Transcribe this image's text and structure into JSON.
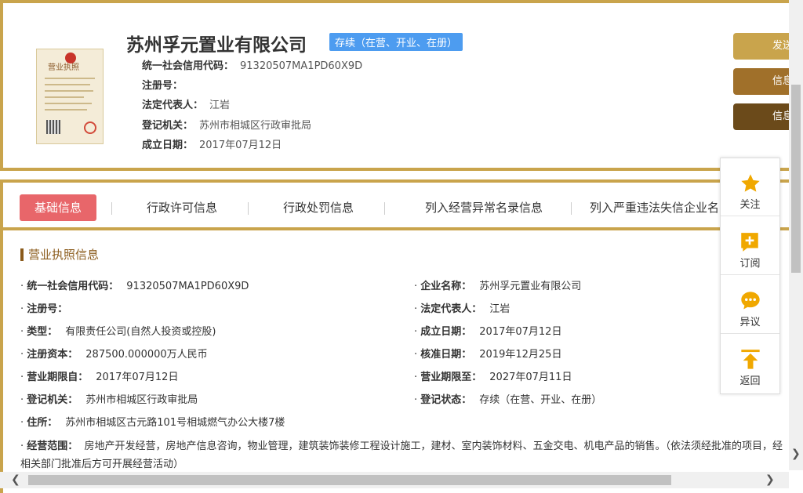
{
  "header": {
    "company_name": "苏州孚元置业有限公司",
    "status": "存续（在营、开业、在册）",
    "license_image": {
      "title": "营业执照"
    },
    "rows": [
      {
        "label": "统一社会信用代码：",
        "value": "91320507MA1PD60X9D"
      },
      {
        "label": "注册号：",
        "value": ""
      },
      {
        "label": "法定代表人：",
        "value": "江岩"
      },
      {
        "label": "登记机关：",
        "value": "苏州市相城区行政审批局"
      },
      {
        "label": "成立日期：",
        "value": "2017年07月12日"
      }
    ],
    "side_buttons": [
      {
        "label": "发送",
        "color": "#c9a44c"
      },
      {
        "label": "信息",
        "color": "#a0702a"
      },
      {
        "label": "信息",
        "color": "#6b4a1a"
      }
    ]
  },
  "tabs": [
    {
      "label": "基础信息",
      "active": true
    },
    {
      "label": "行政许可信息"
    },
    {
      "label": "行政处罚信息"
    },
    {
      "label": "列入经营异常名录信息"
    },
    {
      "label": "列入严重违法失信企业名"
    }
  ],
  "section": {
    "title": "营业执照信息"
  },
  "fields_left": [
    {
      "label": "统一社会信用代码：",
      "value": "91320507MA1PD60X9D"
    },
    {
      "label": "注册号：",
      "value": ""
    },
    {
      "label": "类型：",
      "value": "有限责任公司(自然人投资或控股)"
    },
    {
      "label": "注册资本：",
      "value": "287500.000000万人民币"
    },
    {
      "label": "营业期限自：",
      "value": "2017年07月12日"
    },
    {
      "label": "登记机关：",
      "value": "苏州市相城区行政审批局"
    },
    {
      "label": "住所：",
      "value": "苏州市相城区古元路101号相城燃气办公大楼7楼"
    }
  ],
  "fields_right": [
    {
      "label": "企业名称：",
      "value": "苏州孚元置业有限公司"
    },
    {
      "label": "法定代表人：",
      "value": "江岩"
    },
    {
      "label": "成立日期：",
      "value": "2017年07月12日"
    },
    {
      "label": "核准日期：",
      "value": "2019年12月25日"
    },
    {
      "label": "营业期限至：",
      "value": "2027年07月11日"
    },
    {
      "label": "登记状态：",
      "value": "存续（在营、开业、在册）"
    }
  ],
  "scope": {
    "label": "经营范围：",
    "value": "房地产开发经营，房地产信息咨询，物业管理，建筑装饰装修工程设计施工，建材、室内装饰材料、五金交电、机电产品的销售。（依法须经批准的项目，经相关部门批准后方可开展经营活动）"
  },
  "float_panel": [
    {
      "label": "关注",
      "icon": "star-icon"
    },
    {
      "label": "订阅",
      "icon": "subscribe-icon"
    },
    {
      "label": "异议",
      "icon": "chat-icon"
    },
    {
      "label": "返回",
      "icon": "back-to-top-icon"
    }
  ],
  "colors": {
    "gold": "#c9a44c",
    "active_tab": "#e8666a",
    "status_badge": "#4d9cf0",
    "icon_orange": "#f0a800"
  }
}
